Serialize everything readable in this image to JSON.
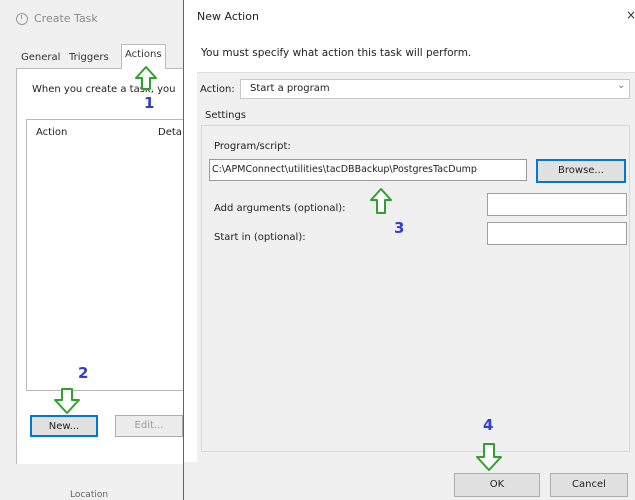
{
  "background_window": {
    "title": "Create Task",
    "tabs": [
      "General",
      "Triggers",
      "Actions"
    ],
    "description": "When you create a task, you",
    "table_columns": [
      "Action",
      "Deta"
    ],
    "new_label": "New...",
    "edit_label": "Edit...",
    "footer_text": "Location"
  },
  "dialog": {
    "title": "New Action",
    "close_glyph": "×",
    "instruction": "You must specify what action this task will perform.",
    "action_label": "Action:",
    "action_value": "Start a program",
    "settings_label": "Settings",
    "program_label": "Program/script:",
    "program_value": "C:\\APMConnect\\utilities\\tacDBBackup\\PostgresTacDump",
    "browse_label": "Browse...",
    "args_label": "Add arguments (optional):",
    "args_value": "",
    "start_label": "Start in (optional):",
    "start_value": "",
    "ok_label": "OK",
    "cancel_label": "Cancel"
  },
  "annotations": {
    "step1": "1",
    "step2": "2",
    "step3": "3",
    "step4": "4",
    "arrow_color": "#2fa12f",
    "number_color": "#3040d0"
  },
  "colors": {
    "accent": "#0078d7",
    "window_bg": "#f0f0f0"
  }
}
